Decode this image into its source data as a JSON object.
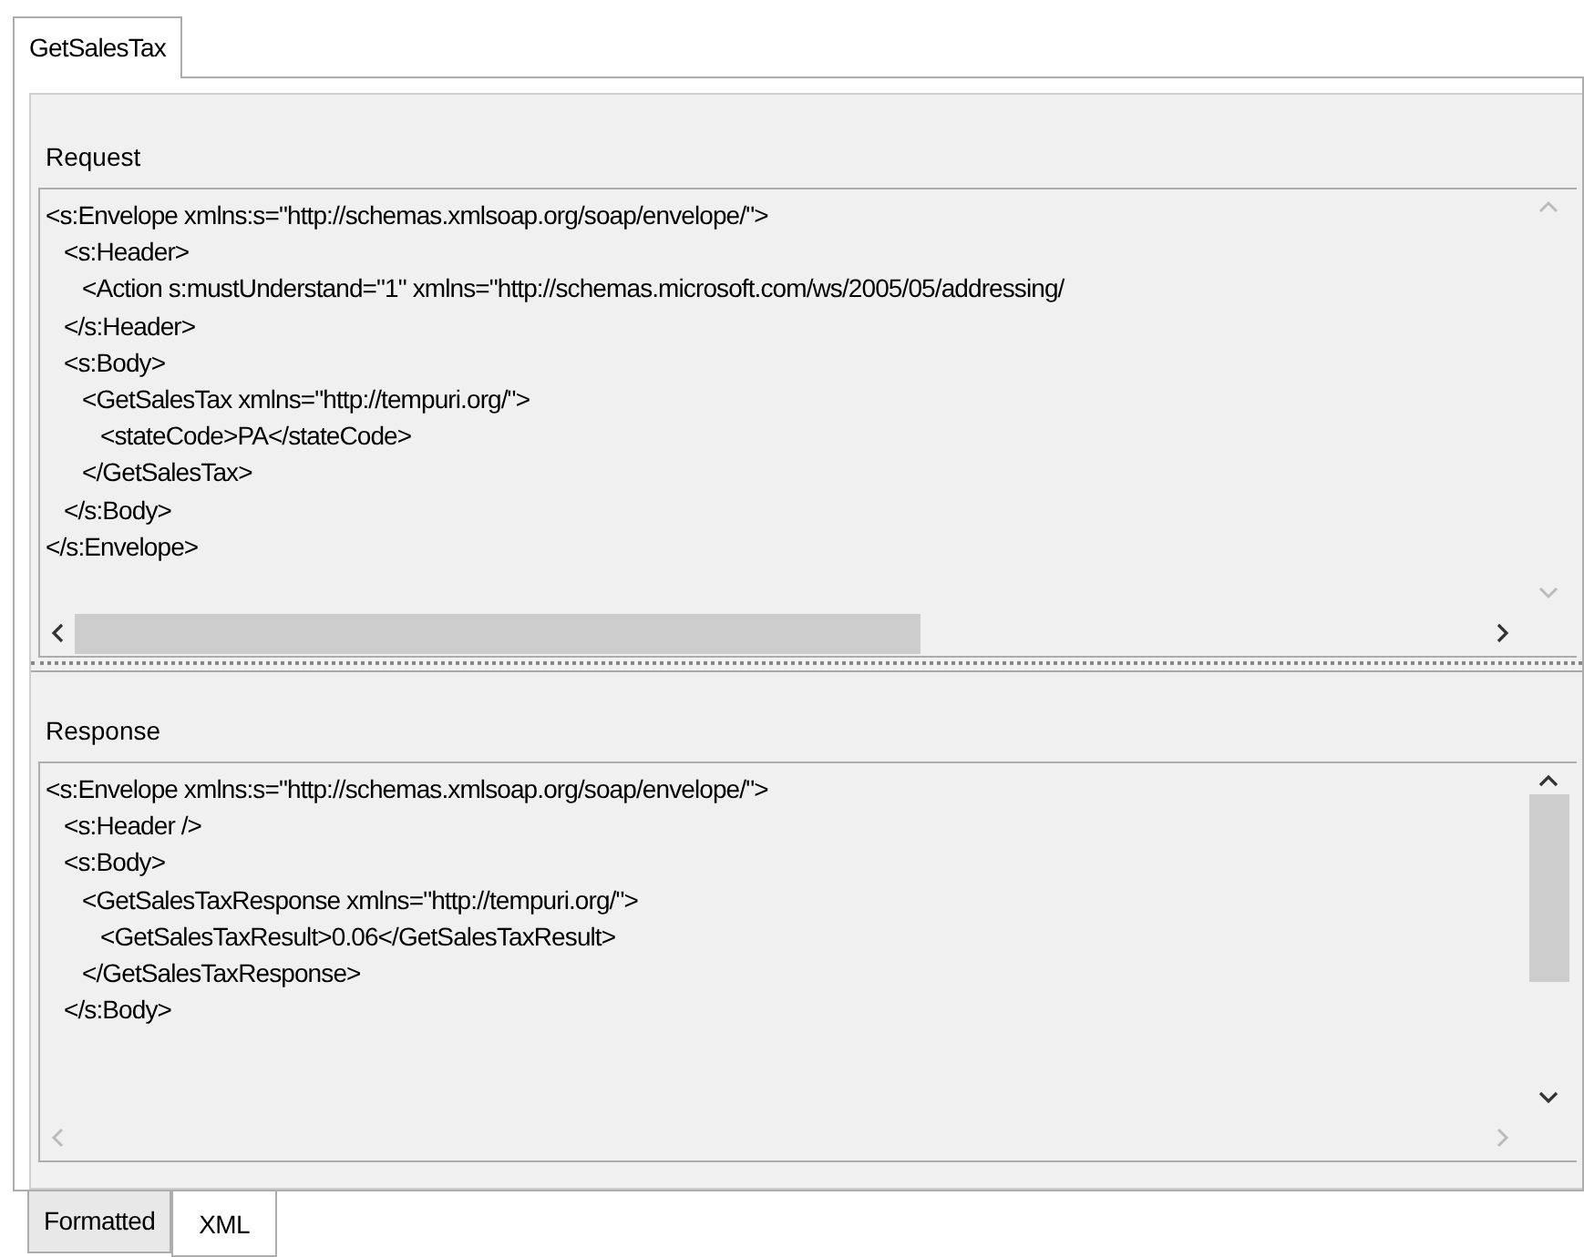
{
  "top_tabs": [
    {
      "label": "GetSalesTax",
      "selected": true
    }
  ],
  "request": {
    "label": "Request",
    "lines": [
      {
        "text": "<s:Envelope xmlns:s=\"http://schemas.xmlsoap.org/soap/envelope/\">",
        "children": [
          {
            "text": "<s:Header>",
            "children": [
              {
                "text": "<Action s:mustUnderstand=\"1\" xmlns=\"http://schemas.microsoft.com/ws/2005/05/addressing/"
              }
            ]
          },
          {
            "text": "</s:Header>"
          },
          {
            "text": "<s:Body>",
            "children": [
              {
                "text": "<GetSalesTax xmlns=\"http://tempuri.org/\">",
                "children": [
                  {
                    "text": "<stateCode>PA</stateCode>"
                  }
                ]
              },
              {
                "text": "</GetSalesTax>"
              }
            ]
          },
          {
            "text": "</s:Body>"
          }
        ]
      },
      {
        "text": "</s:Envelope>"
      }
    ]
  },
  "response": {
    "label": "Response",
    "lines": [
      {
        "text": "<s:Envelope xmlns:s=\"http://schemas.xmlsoap.org/soap/envelope/\">",
        "children": [
          {
            "text": "<s:Header />"
          },
          {
            "text": "<s:Body>",
            "children": [
              {
                "text": "<GetSalesTaxResponse xmlns=\"http://tempuri.org/\">",
                "children": [
                  {
                    "text": "<GetSalesTaxResult>0.06</GetSalesTaxResult>"
                  }
                ]
              },
              {
                "text": "</GetSalesTaxResponse>"
              }
            ]
          },
          {
            "text": "</s:Body>"
          }
        ]
      }
    ]
  },
  "view_tabs": [
    {
      "label": "Formatted",
      "selected": false
    },
    {
      "label": "XML",
      "selected": true
    }
  ]
}
